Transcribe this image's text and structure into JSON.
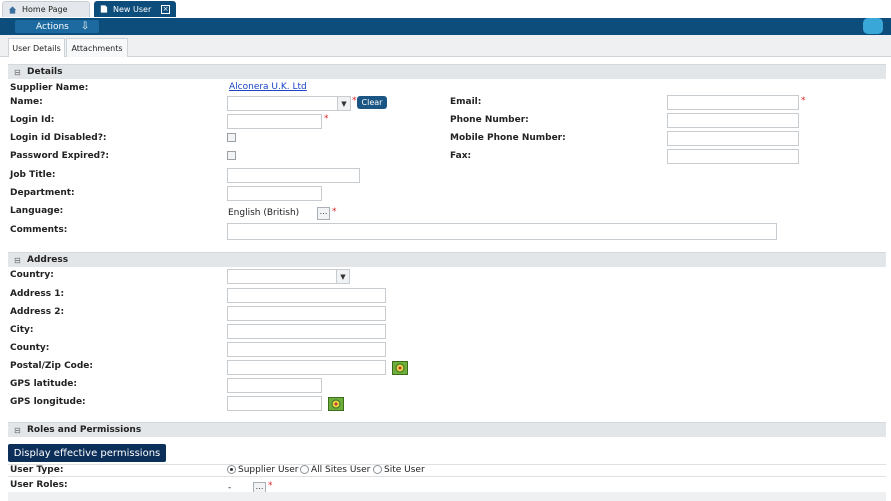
{
  "tabs": {
    "home": "Home Page",
    "new_user": "New User"
  },
  "toolbar": {
    "actions_label": "Actions"
  },
  "subtabs": [
    "User Details",
    "Attachments"
  ],
  "details": {
    "section_title": "Details",
    "supplier_name_label": "Supplier Name:",
    "supplier_name_value": "Alconera U.K. Ltd",
    "name_label": "Name:",
    "clear_label": "Clear",
    "email_label": "Email:",
    "login_id_label": "Login Id:",
    "phone_label": "Phone Number:",
    "login_disabled_label": "Login id Disabled?:",
    "mobile_label": "Mobile Phone Number:",
    "password_expired_label": "Password Expired?:",
    "fax_label": "Fax:",
    "job_title_label": "Job Title:",
    "department_label": "Department:",
    "language_label": "Language:",
    "language_value": "English (British)",
    "comments_label": "Comments:"
  },
  "address": {
    "section_title": "Address",
    "country_label": "Country:",
    "address1_label": "Address 1:",
    "address2_label": "Address 2:",
    "city_label": "City:",
    "county_label": "County:",
    "postal_label": "Postal/Zip Code:",
    "gps_lat_label": "GPS latitude:",
    "gps_long_label": "GPS longitude:"
  },
  "roles": {
    "section_title": "Roles and Permissions",
    "display_button": "Display effective permissions",
    "user_type_label": "User Type:",
    "user_type_options": [
      "Supplier User",
      "All Sites User",
      "Site User"
    ],
    "user_type_selected": "Supplier User",
    "user_roles_label": "User Roles:",
    "user_roles_value": "-"
  },
  "required_marker": "*",
  "colors": {
    "header_blue": "#0d4d7c",
    "button_blue": "#1b5584",
    "link_blue": "#1a43c8",
    "required_red": "#d22222",
    "section_grey": "#e3e6e9"
  }
}
